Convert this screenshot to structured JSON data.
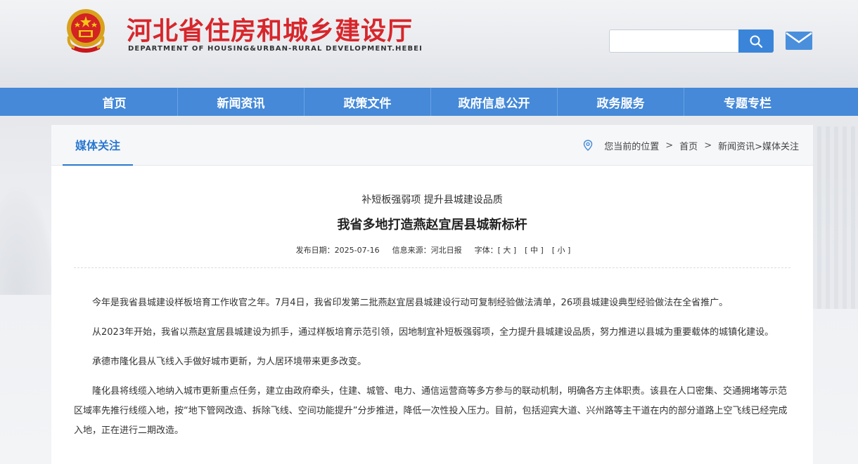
{
  "header": {
    "title": "河北省住房和城乡建设厅",
    "subtitle": "DEPARTMENT OF HOUSING&URBAN-RURAL DEVELOPMENT.HEBEI",
    "search_placeholder": "",
    "search_icon": "search-icon",
    "mail_icon": "mail-icon",
    "emblem_icon": "national-emblem"
  },
  "nav": {
    "items": [
      {
        "label": "首页"
      },
      {
        "label": "新闻资讯"
      },
      {
        "label": "政策文件"
      },
      {
        "label": "政府信息公开"
      },
      {
        "label": "政务服务"
      },
      {
        "label": "专题专栏"
      }
    ]
  },
  "section": {
    "tab_label": "媒体关注"
  },
  "breadcrumb": {
    "prefix": "您当前的位置",
    "home": "首页",
    "path": "新闻资讯>媒体关注",
    "separator": ">"
  },
  "article": {
    "subtitle": "补短板强弱项 提升县城建设品质",
    "title": "我省多地打造燕赵宜居县城新标杆",
    "date_label": "发布日期：",
    "date": "2025-07-16",
    "source_label": "信息来源：",
    "source": "河北日报",
    "font_label": "字体：",
    "font_large": "[ 大 ]",
    "font_medium": "[ 中 ]",
    "font_small": "[ 小 ]",
    "paragraphs": [
      "今年是我省县城建设样板培育工作收官之年。7月4日，我省印发第二批燕赵宜居县城建设行动可复制经验做法清单，26项县城建设典型经验做法在全省推广。",
      "从2023年开始，我省以燕赵宜居县城建设为抓手，通过样板培育示范引领，因地制宜补短板强弱项，全力提升县城建设品质，努力推进以县城为重要载体的城镇化建设。",
      "承德市隆化县从飞线入手做好城市更新，为人居环境带来更多改变。",
      "隆化县将线缆入地纳入城市更新重点任务，建立由政府牵头，住建、城管、电力、通信运营商等多方参与的联动机制，明确各方主体职责。该县在人口密集、交通拥堵等示范区域率先推行线缆入地，按“地下管网改造、拆除飞线、空间功能提升”分步推进，降低一次性投入压力。目前，包括迎宾大道、兴州路等主干道在内的部分道路上空飞线已经完成入地，正在进行二期改造。"
    ]
  },
  "colors": {
    "brand_red": "#d7262b",
    "nav_blue": "#4589d8",
    "accent_blue": "#2a78cf"
  }
}
